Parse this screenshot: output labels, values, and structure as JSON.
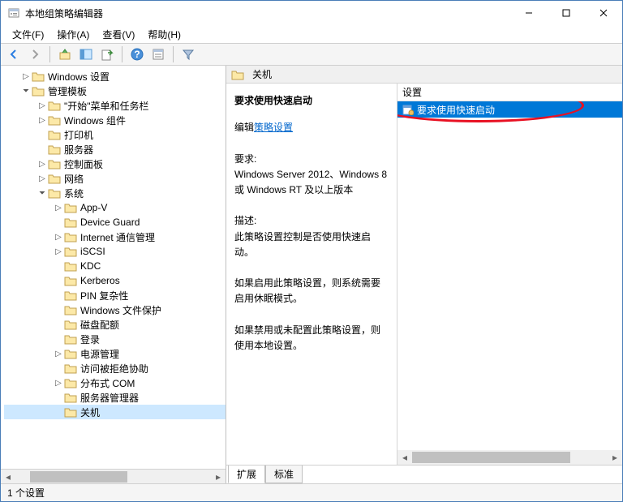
{
  "window": {
    "title": "本地组策略编辑器"
  },
  "menu": {
    "file": "文件(F)",
    "action": "操作(A)",
    "view": "查看(V)",
    "help": "帮助(H)"
  },
  "tree": {
    "n0": "Windows 设置",
    "n1": "管理模板",
    "n2": "\"开始\"菜单和任务栏",
    "n3": "Windows 组件",
    "n4": "打印机",
    "n5": "服务器",
    "n6": "控制面板",
    "n7": "网络",
    "n8": "系统",
    "n9": "App-V",
    "n10": "Device Guard",
    "n11": "Internet 通信管理",
    "n12": "iSCSI",
    "n13": "KDC",
    "n14": "Kerberos",
    "n15": "PIN 复杂性",
    "n16": "Windows 文件保护",
    "n17": "磁盘配额",
    "n18": "登录",
    "n19": "电源管理",
    "n20": "访问被拒绝协助",
    "n21": "分布式 COM",
    "n22": "服务器管理器",
    "n23": "关机"
  },
  "right": {
    "header_title": "关机",
    "setting_label": "设置",
    "desc_title": "要求使用快速启动",
    "edit_prefix": "编辑",
    "edit_link": "策略设置",
    "req_label": "要求:",
    "req_text": "Windows Server 2012、Windows 8 或 Windows RT 及以上版本",
    "desc_label": "描述:",
    "desc_text": "此策略设置控制是否使用快速启动。",
    "para1": "如果启用此策略设置，则系统需要启用休眠模式。",
    "para2": "如果禁用或未配置此策略设置，则使用本地设置。",
    "list_item": "要求使用快速启动"
  },
  "tabs": {
    "extended": "扩展",
    "standard": "标准"
  },
  "status": {
    "text": "1 个设置"
  }
}
